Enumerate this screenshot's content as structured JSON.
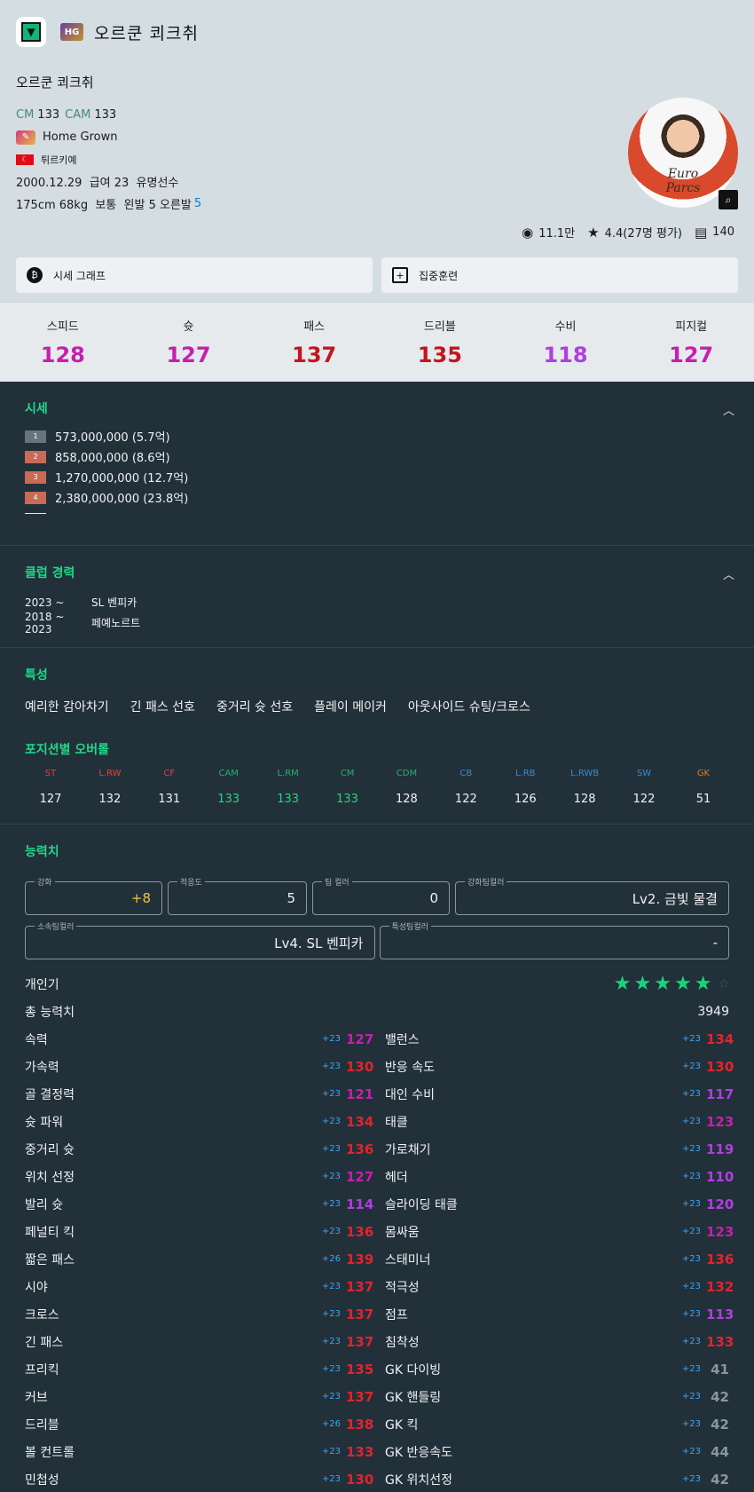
{
  "header": {
    "name": "오르쿤 쾨크취",
    "badge": "HG"
  },
  "player": {
    "name": "오르쿤 쾨크취",
    "positions": [
      {
        "pos": "CM",
        "val": "133"
      },
      {
        "pos": "CAM",
        "val": "133"
      }
    ],
    "trait": "Home Grown",
    "nation": "튀르키예",
    "birth_salary": "2000.12.29  급여 23  유명선수",
    "physique": "175cm 68kg  보통  왼발 5 오른발",
    "right_foot": "5"
  },
  "meta": {
    "views": "11.1만",
    "rating": "4.4(27명 평가)",
    "comments": "140"
  },
  "actions": {
    "price_graph": "시세 그래프",
    "training": "집중훈련"
  },
  "stats": [
    {
      "label": "스피드",
      "value": "128",
      "color": "#c61fae"
    },
    {
      "label": "슛",
      "value": "127",
      "color": "#c61fae"
    },
    {
      "label": "패스",
      "value": "137",
      "color": "#c4141f"
    },
    {
      "label": "드리블",
      "value": "135",
      "color": "#c4141f"
    },
    {
      "label": "수비",
      "value": "118",
      "color": "#b03ee0"
    },
    {
      "label": "피지컬",
      "value": "127",
      "color": "#c61fae"
    }
  ],
  "price": {
    "title": "시세",
    "rows": [
      {
        "badge": "1",
        "text": "573,000,000 (5.7억)",
        "color": "#68747c"
      },
      {
        "badge": "2",
        "text": "858,000,000 (8.6억)",
        "color": "#c86a55"
      },
      {
        "badge": "3",
        "text": "1,270,000,000 (12.7억)",
        "color": "#c86a55"
      },
      {
        "badge": "4",
        "text": "2,380,000,000 (23.8억)",
        "color": "#c86a55"
      }
    ]
  },
  "club": {
    "title": "클럽 경력",
    "rows": [
      {
        "years": "2023 ~",
        "club": "SL 벤피카"
      },
      {
        "years": "2018 ~ 2023",
        "club": "페예노르트"
      }
    ]
  },
  "traits": {
    "title": "특성",
    "items": [
      "예리한 감아차기",
      "긴 패스 선호",
      "중거리 슛 선호",
      "플레이 메이커",
      "아웃사이드 슈팅/크로스"
    ]
  },
  "position_ovr": {
    "title": "포지션별 오버롤",
    "items": [
      {
        "pos": "ST",
        "val": "127",
        "pcolor": "#e0453c",
        "vcolor": "#f0f2f4"
      },
      {
        "pos": "L.RW",
        "val": "132",
        "pcolor": "#e0453c",
        "vcolor": "#f0f2f4"
      },
      {
        "pos": "CF",
        "val": "131",
        "pcolor": "#e0453c",
        "vcolor": "#f0f2f4"
      },
      {
        "pos": "CAM",
        "val": "133",
        "pcolor": "#22b46a",
        "vcolor": "#22d87e"
      },
      {
        "pos": "L.RM",
        "val": "133",
        "pcolor": "#22b46a",
        "vcolor": "#22d87e"
      },
      {
        "pos": "CM",
        "val": "133",
        "pcolor": "#22b46a",
        "vcolor": "#22d87e"
      },
      {
        "pos": "CDM",
        "val": "128",
        "pcolor": "#22b46a",
        "vcolor": "#f0f2f4"
      },
      {
        "pos": "CB",
        "val": "122",
        "pcolor": "#3a8ad0",
        "vcolor": "#f0f2f4"
      },
      {
        "pos": "L.RB",
        "val": "126",
        "pcolor": "#3a8ad0",
        "vcolor": "#f0f2f4"
      },
      {
        "pos": "L.RWB",
        "val": "128",
        "pcolor": "#3a8ad0",
        "vcolor": "#f0f2f4"
      },
      {
        "pos": "SW",
        "val": "122",
        "pcolor": "#3a8ad0",
        "vcolor": "#f0f2f4"
      },
      {
        "pos": "GK",
        "val": "51",
        "pcolor": "#e07a2a",
        "vcolor": "#f0f2f4"
      }
    ]
  },
  "abilities": {
    "title": "능력치",
    "fields": {
      "enhance_label": "강화",
      "enhance_value": "+8",
      "adapt_label": "적응도",
      "adapt_value": "5",
      "teamcolor_label": "팀 컬러",
      "teamcolor_value": "0",
      "enh_teamcolor_label": "강화팀컬러",
      "enh_teamcolor_value": "Lv2. 금빛 물결",
      "club_teamcolor_label": "소속팀컬러",
      "club_teamcolor_value": "Lv4. SL 벤피카",
      "trait_teamcolor_label": "특성팀컬러",
      "trait_teamcolor_value": "-"
    },
    "skill_label": "개인기",
    "skill_stars": 5,
    "total_label": "총 능력치",
    "total_value": "3949",
    "left": [
      {
        "name": "속력",
        "boost": "+23",
        "val": "127",
        "color": "#c61fae"
      },
      {
        "name": "가속력",
        "boost": "+23",
        "val": "130",
        "color": "#e0242e"
      },
      {
        "name": "골 결정력",
        "boost": "+23",
        "val": "121",
        "color": "#c61fae"
      },
      {
        "name": "슛 파워",
        "boost": "+23",
        "val": "134",
        "color": "#e0242e"
      },
      {
        "name": "중거리 슛",
        "boost": "+23",
        "val": "136",
        "color": "#e0242e"
      },
      {
        "name": "위치 선정",
        "boost": "+23",
        "val": "127",
        "color": "#c61fae"
      },
      {
        "name": "발리 슛",
        "boost": "+23",
        "val": "114",
        "color": "#b03ee0"
      },
      {
        "name": "페널티 킥",
        "boost": "+23",
        "val": "136",
        "color": "#e0242e"
      },
      {
        "name": "짧은 패스",
        "boost": "+26",
        "val": "139",
        "color": "#e0242e"
      },
      {
        "name": "시야",
        "boost": "+23",
        "val": "137",
        "color": "#e0242e"
      },
      {
        "name": "크로스",
        "boost": "+23",
        "val": "137",
        "color": "#e0242e"
      },
      {
        "name": "긴 패스",
        "boost": "+23",
        "val": "137",
        "color": "#e0242e"
      },
      {
        "name": "프리킥",
        "boost": "+23",
        "val": "135",
        "color": "#e0242e"
      },
      {
        "name": "커브",
        "boost": "+23",
        "val": "137",
        "color": "#e0242e"
      },
      {
        "name": "드리블",
        "boost": "+26",
        "val": "138",
        "color": "#e0242e"
      },
      {
        "name": "볼 컨트롤",
        "boost": "+23",
        "val": "133",
        "color": "#e0242e"
      },
      {
        "name": "민첩성",
        "boost": "+23",
        "val": "130",
        "color": "#e0242e"
      }
    ],
    "right": [
      {
        "name": "밸런스",
        "boost": "+23",
        "val": "134",
        "color": "#e0242e"
      },
      {
        "name": "반응 속도",
        "boost": "+23",
        "val": "130",
        "color": "#e0242e"
      },
      {
        "name": "대인 수비",
        "boost": "+23",
        "val": "117",
        "color": "#b03ee0"
      },
      {
        "name": "태클",
        "boost": "+23",
        "val": "123",
        "color": "#c61fae"
      },
      {
        "name": "가로채기",
        "boost": "+23",
        "val": "119",
        "color": "#b03ee0"
      },
      {
        "name": "헤더",
        "boost": "+23",
        "val": "110",
        "color": "#b03ee0"
      },
      {
        "name": "슬라이딩 태클",
        "boost": "+23",
        "val": "120",
        "color": "#b03ee0"
      },
      {
        "name": "몸싸움",
        "boost": "+23",
        "val": "123",
        "color": "#c61fae"
      },
      {
        "name": "스태미너",
        "boost": "+23",
        "val": "136",
        "color": "#e0242e"
      },
      {
        "name": "적극성",
        "boost": "+23",
        "val": "132",
        "color": "#e0242e"
      },
      {
        "name": "점프",
        "boost": "+23",
        "val": "113",
        "color": "#b03ee0"
      },
      {
        "name": "침착성",
        "boost": "+23",
        "val": "133",
        "color": "#e0242e"
      },
      {
        "name": "GK 다이빙",
        "boost": "+23",
        "val": "41",
        "color": "#8a969e"
      },
      {
        "name": "GK 핸들링",
        "boost": "+23",
        "val": "42",
        "color": "#8a969e"
      },
      {
        "name": "GK 킥",
        "boost": "+23",
        "val": "42",
        "color": "#8a969e"
      },
      {
        "name": "GK 반응속도",
        "boost": "+23",
        "val": "44",
        "color": "#8a969e"
      },
      {
        "name": "GK 위치선정",
        "boost": "+23",
        "val": "42",
        "color": "#8a969e"
      }
    ]
  }
}
